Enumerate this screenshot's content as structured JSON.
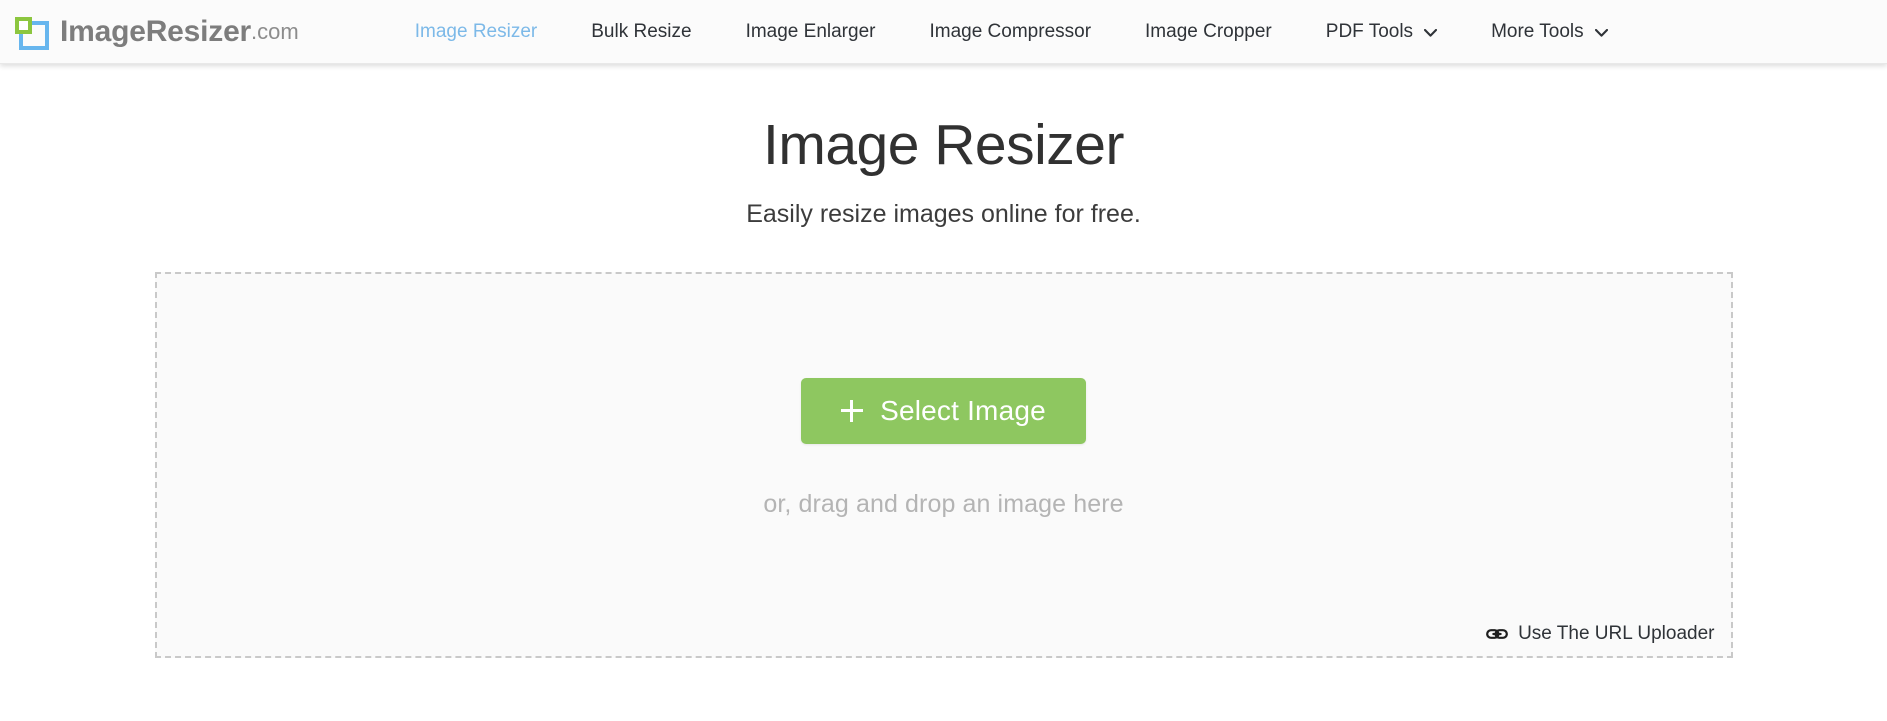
{
  "header": {
    "brand": {
      "name": "ImageResizer",
      "tld": ".com",
      "logo_icon": "resize-frame-icon",
      "logo_accent_color": "#8cc63f",
      "logo_frame_color": "#67b6ee"
    },
    "nav": [
      {
        "label": "Image Resizer",
        "active": true,
        "has_dropdown": false
      },
      {
        "label": "Bulk Resize",
        "active": false,
        "has_dropdown": false
      },
      {
        "label": "Image Enlarger",
        "active": false,
        "has_dropdown": false
      },
      {
        "label": "Image Compressor",
        "active": false,
        "has_dropdown": false
      },
      {
        "label": "Image Cropper",
        "active": false,
        "has_dropdown": false
      },
      {
        "label": "PDF Tools",
        "active": false,
        "has_dropdown": true
      },
      {
        "label": "More Tools",
        "active": false,
        "has_dropdown": true
      }
    ],
    "active_nav_color": "#7cb9e8",
    "nav_text_color": "#2f3338",
    "background": "#fbfbfb"
  },
  "main": {
    "title": "Image Resizer",
    "subtitle": "Easily resize images online for free.",
    "dropzone": {
      "select_button_label": "Select Image",
      "select_button_icon": "plus-icon",
      "select_button_color": "#8ec760",
      "drag_hint": "or, drag and drop an image here",
      "url_uploader_label": "Use The URL Uploader",
      "url_uploader_icon": "link-icon",
      "border_style": "dashed",
      "border_color": "#c9c9c9",
      "background": "#fafafa"
    }
  }
}
